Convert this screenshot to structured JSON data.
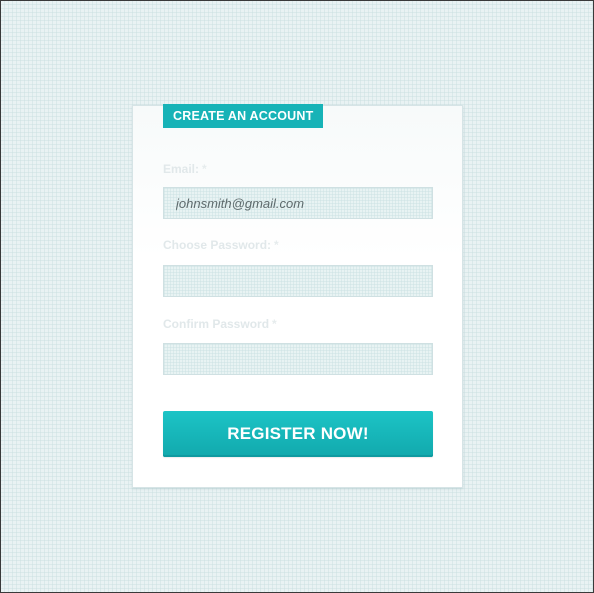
{
  "form": {
    "title": "CREATE AN ACCOUNT",
    "fields": [
      {
        "label": "Email:",
        "required_mark": "*",
        "value": "johnsmith@gmail.com",
        "placeholder": ""
      },
      {
        "label": "Choose Password:",
        "required_mark": "*",
        "value": "",
        "placeholder": ""
      },
      {
        "label": "Confirm Password",
        "required_mark": "*",
        "value": "",
        "placeholder": ""
      }
    ],
    "submit_label": "REGISTER NOW!"
  },
  "colors": {
    "accent": "#17b3b7",
    "background": "#e9f2f3",
    "card": "#ffffff",
    "label": "#e1e8ea"
  }
}
